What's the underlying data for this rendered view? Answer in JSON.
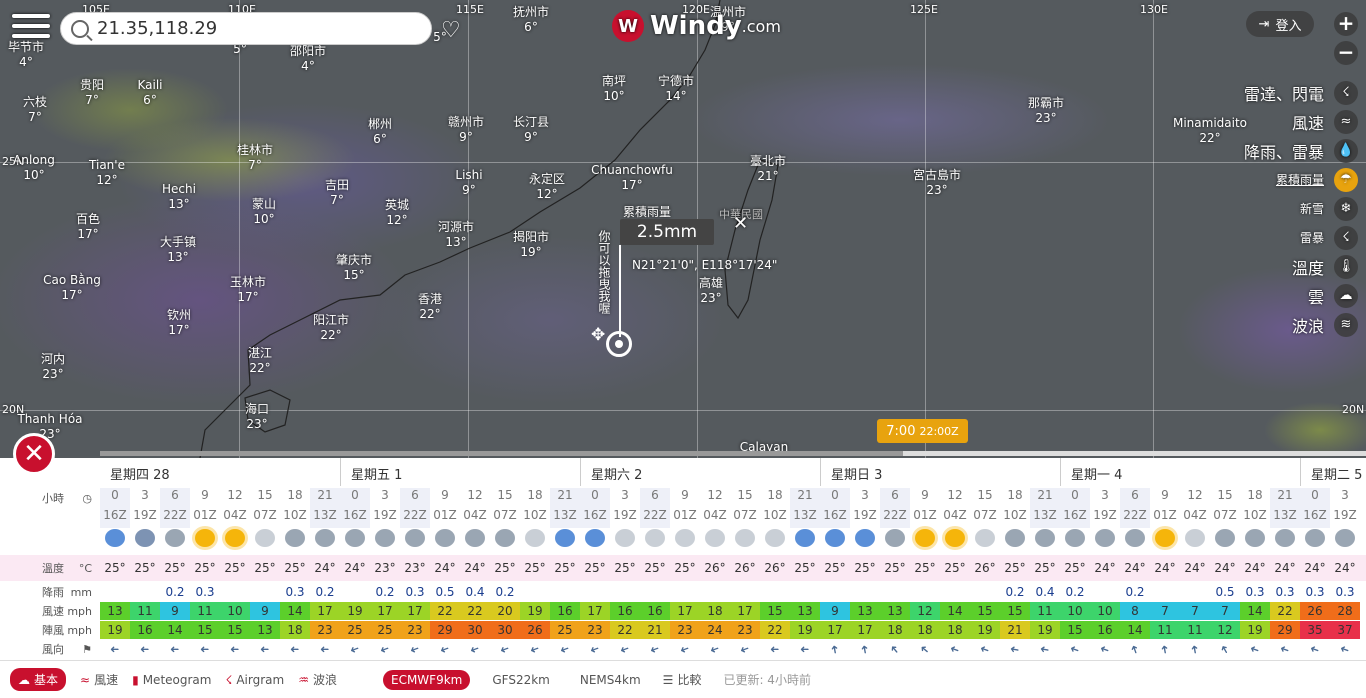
{
  "search": {
    "value": "21.35,118.29"
  },
  "logo": {
    "word": "Windy",
    "com": ".com"
  },
  "login": {
    "label": "登入"
  },
  "zoom": {
    "in": "+",
    "out": "−"
  },
  "layers": [
    {
      "label": "雷達、閃電",
      "size": "big",
      "icon": "☇"
    },
    {
      "label": "風速",
      "size": "big",
      "icon": "≈"
    },
    {
      "label": "降雨、雷暴",
      "size": "big",
      "icon": "💧"
    },
    {
      "label": "累積雨量",
      "size": "sm",
      "icon": "☂",
      "active": true
    },
    {
      "label": "新雪",
      "size": "sm",
      "icon": "❄"
    },
    {
      "label": "雷暴",
      "size": "sm",
      "icon": "☇"
    },
    {
      "label": "溫度",
      "size": "big",
      "icon": "🌡"
    },
    {
      "label": "雲",
      "size": "big",
      "icon": "☁"
    },
    {
      "label": "波浪",
      "size": "big",
      "icon": "≋"
    }
  ],
  "lon_labels": [
    {
      "t": "105E"
    },
    {
      "t": "110E"
    },
    {
      "t": "115E"
    },
    {
      "t": "120E"
    },
    {
      "t": "125E"
    },
    {
      "t": "130E"
    }
  ],
  "lat_labels": [
    {
      "t": "25N"
    },
    {
      "t": "20N"
    },
    {
      "t": "20N"
    }
  ],
  "cities": [
    [
      "毕节市",
      "4°"
    ],
    [
      "贵阳",
      "7°"
    ],
    [
      "Kaili",
      "6°"
    ],
    [
      "六枝",
      "7°"
    ],
    [
      "Anlong",
      "10°"
    ],
    [
      "Tian'e",
      "12°"
    ],
    [
      "桂林市",
      "7°"
    ],
    [
      "Hechi",
      "13°"
    ],
    [
      "蒙山",
      "10°"
    ],
    [
      "吉田",
      "7°"
    ],
    [
      "郴州",
      "6°"
    ],
    [
      "赣州市",
      "9°"
    ],
    [
      "长汀县",
      "9°"
    ],
    [
      "Lishi",
      "9°"
    ],
    [
      "永定区",
      "12°"
    ],
    [
      "英城",
      "12°"
    ],
    [
      "百色",
      "17°"
    ],
    [
      "大手镇",
      "13°"
    ],
    [
      "河源市",
      "13°"
    ],
    [
      "揭阳市",
      "19°"
    ],
    [
      "肇庆市",
      "15°"
    ],
    [
      "玉林市",
      "17°"
    ],
    [
      "Cao Bằng",
      "17°"
    ],
    [
      "钦州",
      "17°"
    ],
    [
      "香港",
      "22°"
    ],
    [
      "阳江市",
      "22°"
    ],
    [
      "湛江",
      "22°"
    ],
    [
      "河内",
      "23°"
    ],
    [
      "海口",
      "23°"
    ],
    [
      "Thanh Hóa",
      "23°"
    ],
    [
      "南坪",
      "10°"
    ],
    [
      "宁德市",
      "14°"
    ],
    [
      "Chuanchowfu",
      "17°"
    ],
    [
      "臺北市",
      "21°"
    ],
    [
      "高雄",
      "23°"
    ],
    [
      "宮古島市",
      "23°"
    ],
    [
      "那霸市",
      "23°"
    ],
    [
      "Minamidaito",
      "22°"
    ],
    [
      "邵阳市",
      "4°"
    ],
    [
      "抚州市",
      "6°"
    ],
    [
      "温州市",
      "9°"
    ],
    [
      "Calayan",
      ""
    ],
    [
      "",
      "5°"
    ],
    [
      "",
      "5°"
    ]
  ],
  "map_label_taiwan": "中華民國",
  "popup": {
    "label": "累積雨量",
    "value": "2.5mm",
    "coord": "N21°21'0\", E118°17'24\"",
    "hint": "你可以拖曳我喔",
    "close": "✕"
  },
  "time": {
    "local": "7:00",
    "utc": "22:00Z",
    "progress_fraction": 0.634
  },
  "days": [
    "星期四 28",
    "星期五 1",
    "星期六 2",
    "星期日 3",
    "星期一 4",
    "星期二 5"
  ],
  "labels": {
    "hours": "小時",
    "temp": "溫度",
    "temp_unit": "°C",
    "rain": "降雨",
    "rain_unit": "mm",
    "wind": "風速",
    "wind_unit": "mph",
    "gust": "陣風",
    "gust_unit": "mph",
    "dir": "風向"
  },
  "hours": [
    "0",
    "3",
    "6",
    "9",
    "12",
    "15",
    "18",
    "21",
    "0",
    "3",
    "6",
    "9",
    "12",
    "15",
    "18",
    "21",
    "0",
    "3",
    "6",
    "9",
    "12",
    "15",
    "18",
    "21",
    "0",
    "3",
    "6",
    "9",
    "12",
    "15",
    "18",
    "21",
    "0",
    "3",
    "6",
    "9",
    "12",
    "15",
    "18",
    "21",
    "0",
    "3"
  ],
  "utc": [
    "16Z",
    "19Z",
    "22Z",
    "01Z",
    "04Z",
    "07Z",
    "10Z",
    "13Z",
    "16Z",
    "19Z",
    "22Z",
    "01Z",
    "04Z",
    "07Z",
    "10Z",
    "13Z",
    "16Z",
    "19Z",
    "22Z",
    "01Z",
    "04Z",
    "07Z",
    "10Z",
    "13Z",
    "16Z",
    "19Z",
    "22Z",
    "01Z",
    "04Z",
    "07Z",
    "10Z",
    "13Z",
    "16Z",
    "19Z",
    "22Z",
    "01Z",
    "04Z",
    "07Z",
    "10Z",
    "13Z",
    "16Z",
    "19Z"
  ],
  "weather": [
    "night-partly",
    "night-rain",
    "rain",
    "sun",
    "sun",
    "cloud",
    "rain",
    "rain",
    "rain",
    "rain",
    "rain",
    "rain",
    "rain",
    "rain",
    "cloud",
    "night-partly",
    "night-partly",
    "cloud",
    "cloud",
    "cloud",
    "cloud",
    "cloud",
    "cloud",
    "night-partly",
    "night-partly",
    "night-partly",
    "rain",
    "sun",
    "sun",
    "cloud",
    "rain",
    "rain",
    "rain",
    "rain",
    "rain",
    "sun",
    "cloud",
    "rain",
    "rain",
    "rain",
    "rain",
    "rain"
  ],
  "temp": [
    "25°",
    "25°",
    "25°",
    "25°",
    "25°",
    "25°",
    "25°",
    "24°",
    "24°",
    "23°",
    "23°",
    "24°",
    "24°",
    "25°",
    "25°",
    "25°",
    "25°",
    "25°",
    "25°",
    "25°",
    "26°",
    "26°",
    "26°",
    "25°",
    "25°",
    "25°",
    "25°",
    "25°",
    "25°",
    "26°",
    "25°",
    "25°",
    "25°",
    "24°",
    "24°",
    "24°",
    "24°",
    "24°",
    "24°",
    "24°",
    "24°",
    "24°"
  ],
  "rain": [
    "",
    "",
    "0.2",
    "0.3",
    "",
    "",
    "0.3",
    "0.2",
    "",
    "0.2",
    "0.3",
    "0.5",
    "0.4",
    "0.2",
    "",
    "",
    "",
    "",
    "",
    "",
    "",
    "",
    "",
    "",
    "",
    "",
    "",
    "",
    "",
    "",
    "0.2",
    "0.4",
    "0.2",
    "",
    "0.2",
    "",
    "",
    "0.5",
    "0.3",
    "0.3",
    "0.3",
    "0.3"
  ],
  "wind": [
    "13",
    "11",
    "9",
    "11",
    "10",
    "9",
    "14",
    "17",
    "19",
    "17",
    "17",
    "22",
    "22",
    "20",
    "19",
    "16",
    "17",
    "16",
    "16",
    "17",
    "18",
    "17",
    "15",
    "13",
    "9",
    "13",
    "13",
    "12",
    "14",
    "15",
    "15",
    "11",
    "10",
    "10",
    "8",
    "7",
    "7",
    "7",
    "14",
    "22",
    "26",
    "28"
  ],
  "gust": [
    "19",
    "16",
    "14",
    "15",
    "15",
    "13",
    "18",
    "23",
    "25",
    "25",
    "23",
    "29",
    "30",
    "30",
    "26",
    "25",
    "23",
    "22",
    "21",
    "23",
    "24",
    "23",
    "22",
    "19",
    "17",
    "17",
    "18",
    "18",
    "18",
    "19",
    "21",
    "19",
    "15",
    "16",
    "14",
    "11",
    "11",
    "12",
    "19",
    "29",
    "35",
    "37"
  ],
  "dir_arrow": "➜",
  "bottom": {
    "tabs": [
      {
        "label": "基本",
        "icon": "☁",
        "active": true
      },
      {
        "label": "風速",
        "icon": "≈"
      },
      {
        "label": "Meteogram",
        "icon": "▮"
      },
      {
        "label": "Airgram",
        "icon": "☇"
      },
      {
        "label": "波浪",
        "icon": "♒"
      }
    ],
    "models": [
      {
        "label": "ECMWF9km",
        "active": true
      },
      {
        "label": "GFS22km"
      },
      {
        "label": "NEMS4km"
      }
    ],
    "compare": "比較",
    "updated": "已更新: 4小時前"
  },
  "colors": {
    "accent": "#c8102e",
    "time": "#e8a30e"
  }
}
